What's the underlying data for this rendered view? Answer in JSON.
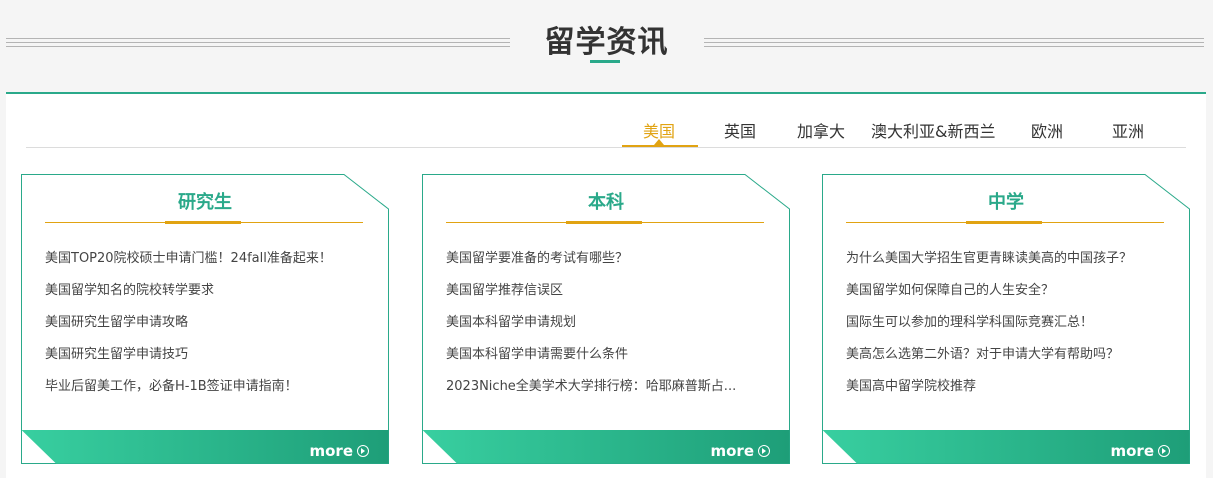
{
  "header": {
    "title": "留学资讯"
  },
  "tabs": [
    {
      "label": "美国",
      "active": true
    },
    {
      "label": "英国"
    },
    {
      "label": "加拿大"
    },
    {
      "label": "澳大利亚&新西兰"
    },
    {
      "label": "欧洲"
    },
    {
      "label": "亚洲"
    }
  ],
  "cards": [
    {
      "title": "研究生",
      "items": [
        "美国TOP20院校硕士申请门槛！24fall准备起来！",
        "美国留学知名的院校转学要求",
        "美国研究生留学申请攻略",
        "美国研究生留学申请技巧",
        "毕业后留美工作，必备H-1B签证申请指南！"
      ],
      "more": "more"
    },
    {
      "title": "本科",
      "items": [
        "美国留学要准备的考试有哪些？",
        "美国留学推荐信误区",
        "美国本科留学申请规划",
        "美国本科留学申请需要什么条件",
        "2023Niche全美学术大学排行榜：哈耶麻普斯占..."
      ],
      "more": "more"
    },
    {
      "title": "中学",
      "items": [
        "为什么美国大学招生官更青睐读美高的中国孩子？",
        "美国留学如何保障自己的人生安全？",
        "国际生可以参加的理科学科国际竞赛汇总！",
        "美高怎么选第二外语？对于申请大学有帮助吗？",
        "美国高中留学院校推荐"
      ],
      "more": "more"
    }
  ],
  "colors": {
    "accent": "#2aa98a",
    "highlight": "#e1a312"
  }
}
